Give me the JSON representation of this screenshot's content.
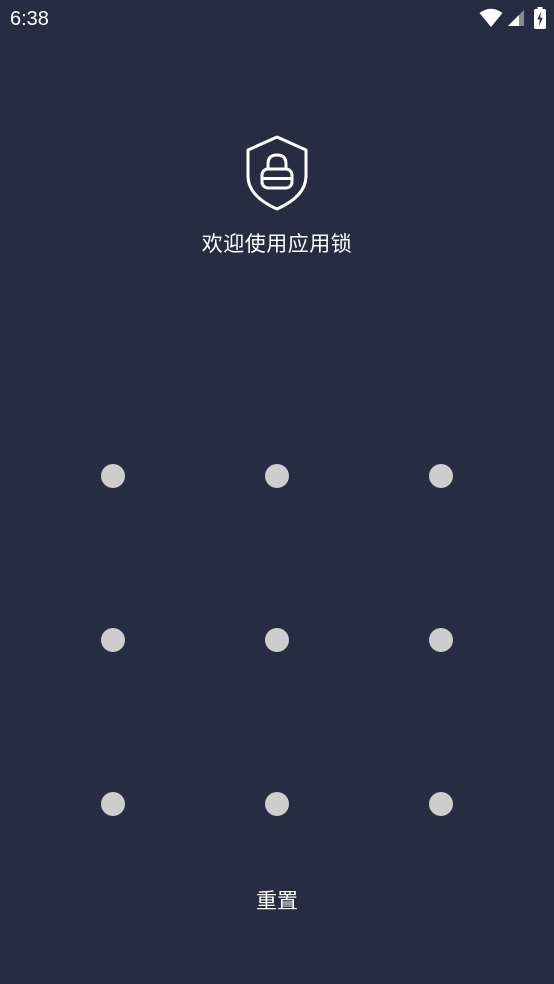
{
  "status_bar": {
    "time": "6:38",
    "icons": [
      "wifi-icon",
      "cellular-signal-icon",
      "battery-charging-icon"
    ]
  },
  "header": {
    "icon": "shield-lock-icon",
    "welcome_text": "欢迎使用应用锁"
  },
  "pattern": {
    "dot_count": 9,
    "dot_color": "#cdcdcd"
  },
  "actions": {
    "reset_label": "重置"
  },
  "colors": {
    "background": "#262d42",
    "text": "#ffffff"
  }
}
